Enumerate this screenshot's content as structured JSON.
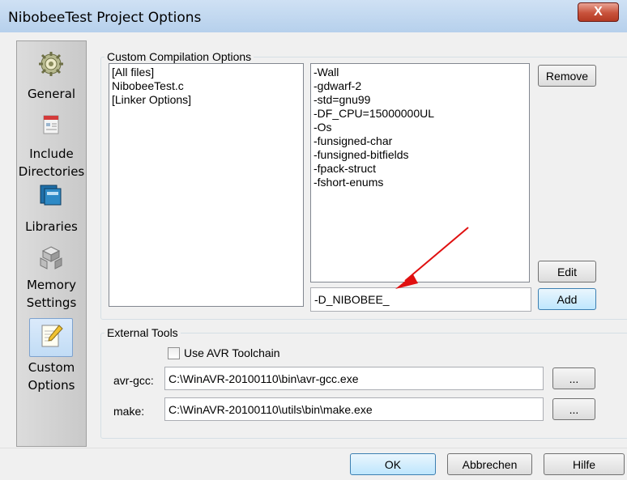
{
  "window": {
    "title": "NibobeeTest Project Options",
    "close_label": "X"
  },
  "sidebar": {
    "items": [
      {
        "label": "General",
        "icon": "gear-icon"
      },
      {
        "label": "Include Directories",
        "icon": "folder-icon"
      },
      {
        "label": "Libraries",
        "icon": "books-icon"
      },
      {
        "label": "Memory Settings",
        "icon": "blocks-icon"
      },
      {
        "label": "Custom Options",
        "icon": "notepad-pencil-icon"
      }
    ],
    "selected": "Custom Options"
  },
  "compilation": {
    "legend": "Custom Compilation Options",
    "files": [
      "[All files]",
      "NibobeeTest.c",
      "[Linker Options]"
    ],
    "options": [
      "-Wall",
      "-gdwarf-2",
      "-std=gnu99",
      "-DF_CPU=15000000UL",
      "-Os",
      "-funsigned-char",
      "-funsigned-bitfields",
      "-fpack-struct",
      "-fshort-enums"
    ],
    "remove_label": "Remove",
    "edit_label": "Edit",
    "add_label": "Add",
    "new_option_value": "-D_NIBOBEE_"
  },
  "external": {
    "legend": "External Tools",
    "use_avr_label": "Use AVR Toolchain",
    "avr_gcc_label": "avr-gcc:",
    "avr_gcc_value": "C:\\WinAVR-20100110\\bin\\avr-gcc.exe",
    "make_label": "make:",
    "make_value": "C:\\WinAVR-20100110\\utils\\bin\\make.exe",
    "browse_label": "..."
  },
  "buttons": {
    "ok": "OK",
    "cancel": "Abbrechen",
    "help": "Hilfe"
  },
  "annotation": {
    "arrow_color": "#e01010"
  }
}
